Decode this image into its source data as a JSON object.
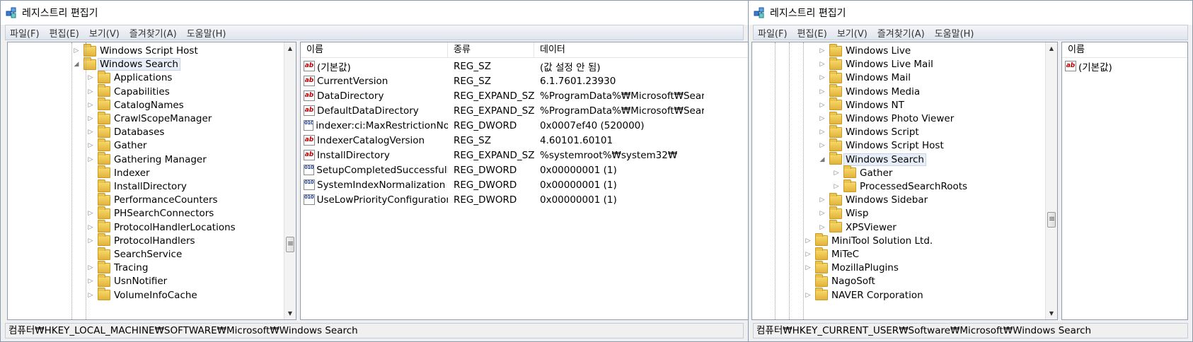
{
  "win1": {
    "title": "레지스트리 편집기",
    "menu": [
      "파일(F)",
      "편집(E)",
      "보기(V)",
      "즐겨찾기(A)",
      "도움말(H)"
    ],
    "tree": [
      {
        "label": "Windows Script Host",
        "level": 0,
        "expander": "collapsed"
      },
      {
        "label": "Windows Search",
        "level": 0,
        "expander": "expanded",
        "selected": true
      },
      {
        "label": "Applications",
        "level": 1,
        "expander": "collapsed"
      },
      {
        "label": "Capabilities",
        "level": 1,
        "expander": "collapsed"
      },
      {
        "label": "CatalogNames",
        "level": 1,
        "expander": "collapsed"
      },
      {
        "label": "CrawlScopeManager",
        "level": 1,
        "expander": "collapsed"
      },
      {
        "label": "Databases",
        "level": 1,
        "expander": "collapsed"
      },
      {
        "label": "Gather",
        "level": 1,
        "expander": "collapsed"
      },
      {
        "label": "Gathering Manager",
        "level": 1,
        "expander": "collapsed"
      },
      {
        "label": "Indexer",
        "level": 1,
        "expander": "none"
      },
      {
        "label": "InstallDirectory",
        "level": 1,
        "expander": "none"
      },
      {
        "label": "PerformanceCounters",
        "level": 1,
        "expander": "none"
      },
      {
        "label": "PHSearchConnectors",
        "level": 1,
        "expander": "collapsed"
      },
      {
        "label": "ProtocolHandlerLocations",
        "level": 1,
        "expander": "collapsed"
      },
      {
        "label": "ProtocolHandlers",
        "level": 1,
        "expander": "collapsed"
      },
      {
        "label": "SearchService",
        "level": 1,
        "expander": "none"
      },
      {
        "label": "Tracing",
        "level": 1,
        "expander": "collapsed"
      },
      {
        "label": "UsnNotifier",
        "level": 1,
        "expander": "collapsed"
      },
      {
        "label": "VolumeInfoCache",
        "level": 1,
        "expander": "collapsed"
      }
    ],
    "columns": [
      "이름",
      "종류",
      "데이터"
    ],
    "values": [
      {
        "icon": "ab",
        "name": "(기본값)",
        "type": "REG_SZ",
        "data": "(값 설정 안 됨)"
      },
      {
        "icon": "ab",
        "name": "CurrentVersion",
        "type": "REG_SZ",
        "data": "6.1.7601.23930"
      },
      {
        "icon": "ab",
        "name": "DataDirectory",
        "type": "REG_EXPAND_SZ",
        "data": "%ProgramData%₩Microsoft₩Search₩D"
      },
      {
        "icon": "ab",
        "name": "DefaultDataDirectory",
        "type": "REG_EXPAND_SZ",
        "data": "%ProgramData%₩Microsoft₩Search₩D"
      },
      {
        "icon": "dw",
        "name": "indexer:ci:MaxRestrictionNodes",
        "type": "REG_DWORD",
        "data": "0x0007ef40 (520000)"
      },
      {
        "icon": "ab",
        "name": "IndexerCatalogVersion",
        "type": "REG_SZ",
        "data": "4.60101.60101"
      },
      {
        "icon": "ab",
        "name": "InstallDirectory",
        "type": "REG_EXPAND_SZ",
        "data": "%systemroot%₩system32₩"
      },
      {
        "icon": "dw",
        "name": "SetupCompletedSuccessfully",
        "type": "REG_DWORD",
        "data": "0x00000001 (1)"
      },
      {
        "icon": "dw",
        "name": "SystemIndexNormalization",
        "type": "REG_DWORD",
        "data": "0x00000001 (1)"
      },
      {
        "icon": "dw",
        "name": "UseLowPriorityConfiguration",
        "type": "REG_DWORD",
        "data": "0x00000001 (1)"
      }
    ],
    "status": "컴퓨터₩HKEY_LOCAL_MACHINE₩SOFTWARE₩Microsoft₩Windows Search"
  },
  "win2": {
    "title": "레지스트리 편집기",
    "menu": [
      "파일(F)",
      "편집(E)",
      "보기(V)",
      "즐겨찾기(A)",
      "도움말(H)"
    ],
    "tree": [
      {
        "label": "Windows Live",
        "level": 1,
        "expander": "collapsed"
      },
      {
        "label": "Windows Live Mail",
        "level": 1,
        "expander": "collapsed"
      },
      {
        "label": "Windows Mail",
        "level": 1,
        "expander": "collapsed"
      },
      {
        "label": "Windows Media",
        "level": 1,
        "expander": "collapsed"
      },
      {
        "label": "Windows NT",
        "level": 1,
        "expander": "collapsed"
      },
      {
        "label": "Windows Photo Viewer",
        "level": 1,
        "expander": "collapsed"
      },
      {
        "label": "Windows Script",
        "level": 1,
        "expander": "collapsed"
      },
      {
        "label": "Windows Script Host",
        "level": 1,
        "expander": "collapsed"
      },
      {
        "label": "Windows Search",
        "level": 1,
        "expander": "expanded",
        "selected": true
      },
      {
        "label": "Gather",
        "level": 2,
        "expander": "collapsed"
      },
      {
        "label": "ProcessedSearchRoots",
        "level": 2,
        "expander": "collapsed"
      },
      {
        "label": "Windows Sidebar",
        "level": 1,
        "expander": "collapsed"
      },
      {
        "label": "Wisp",
        "level": 1,
        "expander": "collapsed"
      },
      {
        "label": "XPSViewer",
        "level": 1,
        "expander": "collapsed"
      },
      {
        "label": "MiniTool Solution Ltd.",
        "level": 0,
        "expander": "collapsed"
      },
      {
        "label": "MiTeC",
        "level": 0,
        "expander": "collapsed"
      },
      {
        "label": "MozillaPlugins",
        "level": 0,
        "expander": "collapsed"
      },
      {
        "label": "NagoSoft",
        "level": 0,
        "expander": "none"
      },
      {
        "label": "NAVER Corporation",
        "level": 0,
        "expander": "collapsed"
      }
    ],
    "columns": [
      "이름"
    ],
    "values": [
      {
        "icon": "ab",
        "name": "(기본값)"
      }
    ],
    "status": "컴퓨터₩HKEY_CURRENT_USER₩Software₩Microsoft₩Windows Search"
  }
}
